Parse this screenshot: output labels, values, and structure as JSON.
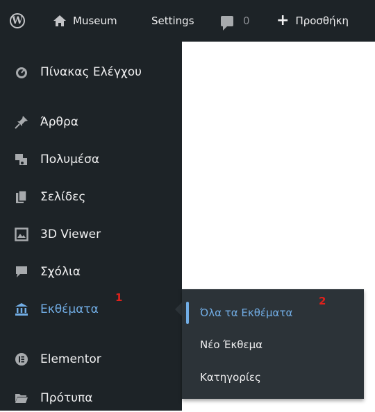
{
  "adminbar": {
    "site_name": "Museum",
    "settings": "Settings",
    "comments_count": "0",
    "new_label": "Προσθήκη"
  },
  "sidebar": {
    "items": [
      {
        "label": "Πίνακας Ελέγχου",
        "icon": "dashboard-icon"
      },
      {
        "label": "Άρθρα",
        "icon": "pin-icon"
      },
      {
        "label": "Πολυμέσα",
        "icon": "media-icon"
      },
      {
        "label": "Σελίδες",
        "icon": "pages-icon"
      },
      {
        "label": "3D Viewer",
        "icon": "image-icon"
      },
      {
        "label": "Σχόλια",
        "icon": "comment-icon"
      },
      {
        "label": "Εκθέματα",
        "icon": "museum-icon"
      },
      {
        "label": "Elementor",
        "icon": "elementor-icon"
      },
      {
        "label": "Πρότυπα",
        "icon": "folder-icon"
      }
    ],
    "current_index": 6
  },
  "submenu": {
    "items": [
      "Όλα τα Εκθέματα",
      "Νέο Έκθεμα",
      "Κατηγορίες"
    ],
    "active_index": 0
  },
  "annotations": [
    "1",
    "2"
  ],
  "colors": {
    "bar": "#1d2327",
    "submenu": "#2c3338",
    "accent": "#72aee6",
    "annotation": "#e0211b"
  }
}
